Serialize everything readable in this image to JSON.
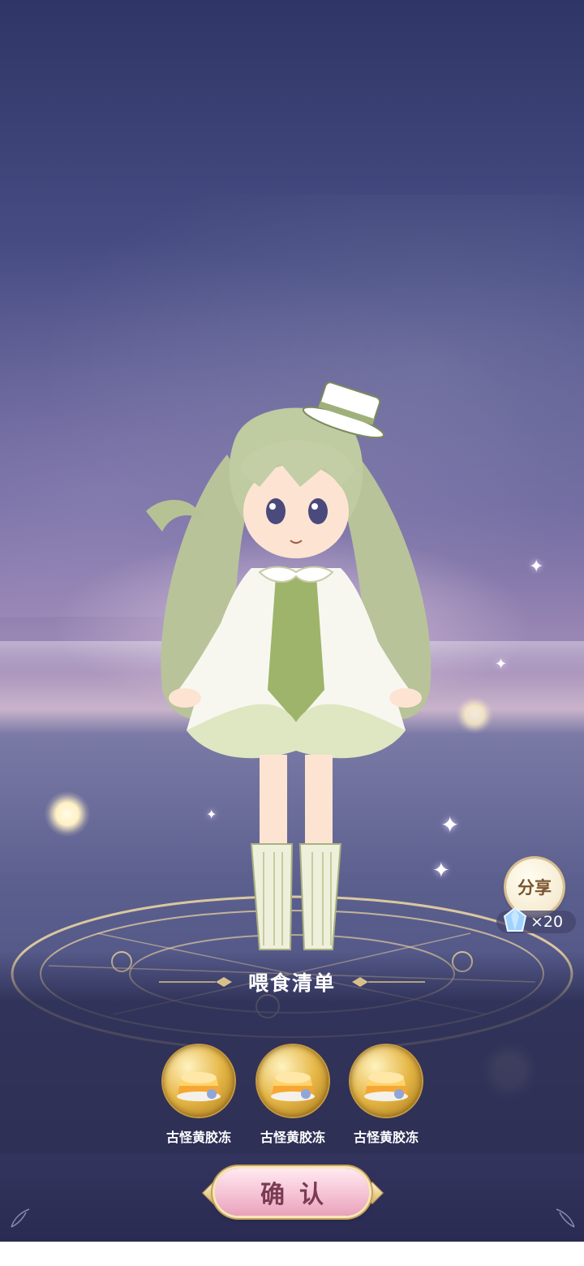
{
  "share": {
    "label": "分享",
    "reward_count": "×20",
    "icon": "gem-icon"
  },
  "feed_panel": {
    "title": "喂食清单",
    "items": [
      {
        "name": "古怪黄胶冻",
        "icon": "pudding-icon"
      },
      {
        "name": "古怪黄胶冻",
        "icon": "pudding-icon"
      },
      {
        "name": "古怪黄胶冻",
        "icon": "pudding-icon"
      }
    ]
  },
  "confirm": {
    "label": "确认"
  },
  "colors": {
    "sky_top": "#2f3566",
    "horizon_glow": "#c9b3cb",
    "panel_bg": "#2d2e52",
    "confirm_pink": "#f5c2d4",
    "gold_accent": "#c7a15c"
  }
}
